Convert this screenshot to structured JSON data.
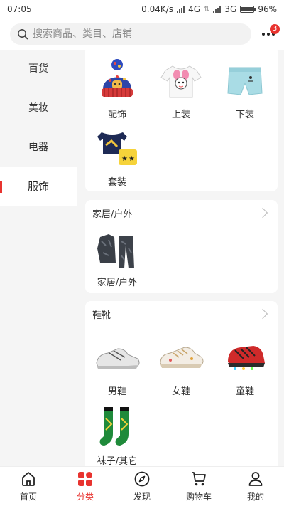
{
  "status_bar": {
    "time": "07:05",
    "speed": "0.04K/s",
    "net1": "4G",
    "net2": "3G",
    "battery": "96%",
    "battery_level": 0.96
  },
  "search": {
    "placeholder": "搜索商品、类目、店铺",
    "badge": "3"
  },
  "sidebar": {
    "items": [
      {
        "label": "百货",
        "active": false
      },
      {
        "label": "美妆",
        "active": false
      },
      {
        "label": "电器",
        "active": false
      },
      {
        "label": "服饰",
        "active": true
      }
    ]
  },
  "sections": [
    {
      "items": [
        "配饰",
        "上装",
        "下装",
        "套装"
      ]
    },
    {
      "title": "家居/户外",
      "items": [
        "家居/户外"
      ]
    },
    {
      "title": "鞋靴",
      "items": [
        "男鞋",
        "女鞋",
        "童鞋",
        "袜子/其它"
      ]
    }
  ],
  "tabs": [
    {
      "label": "首页",
      "icon": "home-icon",
      "active": false
    },
    {
      "label": "分类",
      "icon": "category-icon",
      "active": true
    },
    {
      "label": "发现",
      "icon": "compass-icon",
      "active": false
    },
    {
      "label": "购物车",
      "icon": "cart-icon",
      "active": false
    },
    {
      "label": "我的",
      "icon": "user-icon",
      "active": false
    }
  ],
  "colors": {
    "accent": "#e8332f"
  }
}
